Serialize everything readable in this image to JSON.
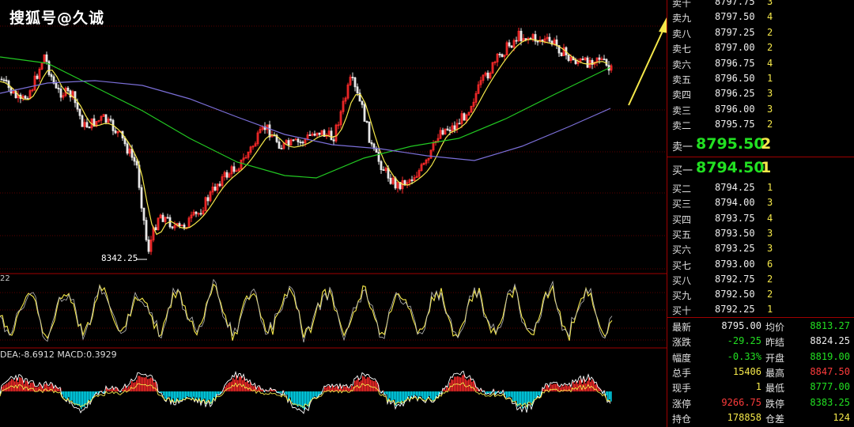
{
  "watermark": "搜狐号@久诚",
  "low_marker": "8342.25",
  "indicator1_label": "22",
  "macd_label": "DEA:-8.6912  MACD:0.3929",
  "colors": {
    "up": "#ff2a2a",
    "down": "#00e5ff",
    "ma_short": "#f5e84a",
    "ma_mid": "#22c922",
    "ma_long": "#7b6fd8",
    "price_green": "#22e022",
    "vol_yellow": "#f5e84a",
    "grid": "#a00000"
  },
  "sell_levels": [
    {
      "label": "卖十",
      "price": "8797.75",
      "vol": "3"
    },
    {
      "label": "卖九",
      "price": "8797.50",
      "vol": "4"
    },
    {
      "label": "卖八",
      "price": "8797.25",
      "vol": "2"
    },
    {
      "label": "卖七",
      "price": "8797.00",
      "vol": "2"
    },
    {
      "label": "卖六",
      "price": "8796.75",
      "vol": "4"
    },
    {
      "label": "卖五",
      "price": "8796.50",
      "vol": "1"
    },
    {
      "label": "卖四",
      "price": "8796.25",
      "vol": "3"
    },
    {
      "label": "卖三",
      "price": "8796.00",
      "vol": "3"
    },
    {
      "label": "卖二",
      "price": "8795.75",
      "vol": "2"
    }
  ],
  "best_ask": {
    "label": "卖一",
    "price": "8795.50",
    "vol": "2"
  },
  "best_bid": {
    "label": "买一",
    "price": "8794.50",
    "vol": "1"
  },
  "buy_levels": [
    {
      "label": "买二",
      "price": "8794.25",
      "vol": "1"
    },
    {
      "label": "买三",
      "price": "8794.00",
      "vol": "3"
    },
    {
      "label": "买四",
      "price": "8793.75",
      "vol": "4"
    },
    {
      "label": "买五",
      "price": "8793.50",
      "vol": "3"
    },
    {
      "label": "买六",
      "price": "8793.25",
      "vol": "3"
    },
    {
      "label": "买七",
      "price": "8793.00",
      "vol": "6"
    },
    {
      "label": "买八",
      "price": "8792.75",
      "vol": "2"
    },
    {
      "label": "买九",
      "price": "8792.50",
      "vol": "2"
    },
    {
      "label": "买十",
      "price": "8792.25",
      "vol": "1"
    }
  ],
  "stats": [
    {
      "l1": "最新",
      "v1": "8795.00",
      "c1": "#f0f0f0",
      "l2": "均价",
      "v2": "8813.27",
      "c2": "#22e022"
    },
    {
      "l1": "涨跌",
      "v1": "-29.25",
      "c1": "#22e022",
      "l2": "昨结",
      "v2": "8824.25",
      "c2": "#f0f0f0"
    },
    {
      "l1": "幅度",
      "v1": "-0.33%",
      "c1": "#22e022",
      "l2": "开盘",
      "v2": "8819.00",
      "c2": "#22e022"
    },
    {
      "l1": "总手",
      "v1": "15406",
      "c1": "#f5e84a",
      "l2": "最高",
      "v2": "8847.50",
      "c2": "#ff3b3b"
    },
    {
      "l1": "现手",
      "v1": "1",
      "c1": "#f5e84a",
      "l2": "最低",
      "v2": "8777.00",
      "c2": "#22e022"
    },
    {
      "l1": "涨停",
      "v1": "9266.75",
      "c1": "#ff3b3b",
      "l2": "跌停",
      "v2": "8383.25",
      "c2": "#22e022"
    },
    {
      "l1": "持仓",
      "v1": "178858",
      "c1": "#f5e84a",
      "l2": "仓差",
      "v2": "124",
      "c2": "#f5e84a"
    }
  ]
}
